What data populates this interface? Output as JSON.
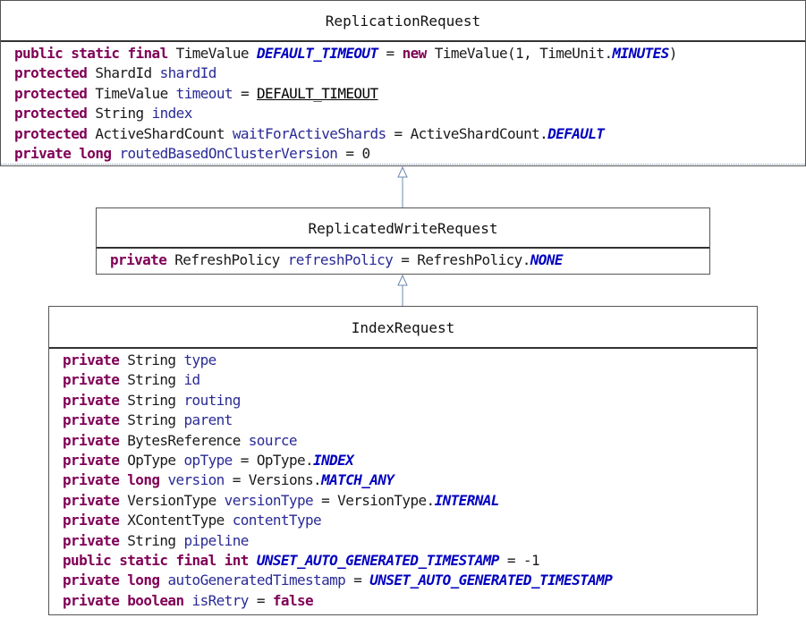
{
  "classes": [
    {
      "name": "ReplicationRequest",
      "fields": [
        [
          {
            "t": "kw",
            "v": "public static final"
          },
          {
            "t": "ty",
            "v": " TimeValue "
          },
          {
            "t": "cn",
            "v": "DEFAULT_TIMEOUT"
          },
          {
            "t": "op",
            "v": " = "
          },
          {
            "t": "kw",
            "v": "new"
          },
          {
            "t": "ty",
            "v": " TimeValue(1, TimeUnit."
          },
          {
            "t": "cn",
            "v": "MINUTES"
          },
          {
            "t": "ty",
            "v": ")"
          }
        ],
        [
          {
            "t": "kw",
            "v": "protected"
          },
          {
            "t": "ty",
            "v": " ShardId "
          },
          {
            "t": "fn",
            "v": "shardId"
          }
        ],
        [
          {
            "t": "kw",
            "v": "protected"
          },
          {
            "t": "ty",
            "v": " TimeValue "
          },
          {
            "t": "fn",
            "v": "timeout"
          },
          {
            "t": "op",
            "v": " = "
          },
          {
            "t": "ul",
            "v": "DEFAULT_TIMEOUT"
          }
        ],
        [
          {
            "t": "kw",
            "v": "protected"
          },
          {
            "t": "ty",
            "v": " String "
          },
          {
            "t": "fn",
            "v": "index"
          }
        ],
        [
          {
            "t": "kw",
            "v": "protected"
          },
          {
            "t": "ty",
            "v": " ActiveShardCount "
          },
          {
            "t": "fn",
            "v": "waitForActiveShards"
          },
          {
            "t": "op",
            "v": " = "
          },
          {
            "t": "ty",
            "v": "ActiveShardCount."
          },
          {
            "t": "cn",
            "v": "DEFAULT"
          }
        ],
        [
          {
            "t": "kw",
            "v": "private long"
          },
          {
            "t": "ty",
            "v": " "
          },
          {
            "t": "fn",
            "v": "routedBasedOnClusterVersion"
          },
          {
            "t": "op",
            "v": " = "
          },
          {
            "t": "lit",
            "v": "0"
          }
        ]
      ]
    },
    {
      "name": "ReplicatedWriteRequest",
      "fields": [
        [
          {
            "t": "kw",
            "v": "private"
          },
          {
            "t": "ty",
            "v": " RefreshPolicy "
          },
          {
            "t": "fn",
            "v": "refreshPolicy"
          },
          {
            "t": "op",
            "v": " = "
          },
          {
            "t": "ty",
            "v": "RefreshPolicy."
          },
          {
            "t": "cn",
            "v": "NONE"
          }
        ]
      ]
    },
    {
      "name": "IndexRequest",
      "fields": [
        [
          {
            "t": "kw",
            "v": "private"
          },
          {
            "t": "ty",
            "v": " String "
          },
          {
            "t": "fn",
            "v": "type"
          }
        ],
        [
          {
            "t": "kw",
            "v": "private"
          },
          {
            "t": "ty",
            "v": " String "
          },
          {
            "t": "fn",
            "v": "id"
          }
        ],
        [
          {
            "t": "kw",
            "v": "private"
          },
          {
            "t": "ty",
            "v": " String "
          },
          {
            "t": "fn",
            "v": "routing"
          }
        ],
        [
          {
            "t": "kw",
            "v": "private"
          },
          {
            "t": "ty",
            "v": " String "
          },
          {
            "t": "fn",
            "v": "parent"
          }
        ],
        [
          {
            "t": "kw",
            "v": "private"
          },
          {
            "t": "ty",
            "v": " BytesReference "
          },
          {
            "t": "fn",
            "v": "source"
          }
        ],
        [
          {
            "t": "kw",
            "v": "private"
          },
          {
            "t": "ty",
            "v": " OpType "
          },
          {
            "t": "fn",
            "v": "opType"
          },
          {
            "t": "op",
            "v": " = "
          },
          {
            "t": "ty",
            "v": "OpType."
          },
          {
            "t": "cn",
            "v": "INDEX"
          }
        ],
        [
          {
            "t": "kw",
            "v": "private long"
          },
          {
            "t": "ty",
            "v": " "
          },
          {
            "t": "fn",
            "v": "version"
          },
          {
            "t": "op",
            "v": " = "
          },
          {
            "t": "ty",
            "v": "Versions."
          },
          {
            "t": "cn",
            "v": "MATCH_ANY"
          }
        ],
        [
          {
            "t": "kw",
            "v": "private"
          },
          {
            "t": "ty",
            "v": " VersionType "
          },
          {
            "t": "fn",
            "v": "versionType"
          },
          {
            "t": "op",
            "v": " = "
          },
          {
            "t": "ty",
            "v": "VersionType."
          },
          {
            "t": "cn",
            "v": "INTERNAL"
          }
        ],
        [
          {
            "t": "kw",
            "v": "private"
          },
          {
            "t": "ty",
            "v": " XContentType "
          },
          {
            "t": "fn",
            "v": "contentType"
          }
        ],
        [
          {
            "t": "kw",
            "v": "private"
          },
          {
            "t": "ty",
            "v": " String "
          },
          {
            "t": "fn",
            "v": "pipeline"
          }
        ],
        [
          {
            "t": "kw",
            "v": "public static final int"
          },
          {
            "t": "ty",
            "v": " "
          },
          {
            "t": "cn",
            "v": "UNSET_AUTO_GENERATED_TIMESTAMP"
          },
          {
            "t": "op",
            "v": " = "
          },
          {
            "t": "lit",
            "v": "-1"
          }
        ],
        [
          {
            "t": "kw",
            "v": "private long"
          },
          {
            "t": "ty",
            "v": " "
          },
          {
            "t": "fn",
            "v": "autoGeneratedTimestamp"
          },
          {
            "t": "op",
            "v": " = "
          },
          {
            "t": "cn",
            "v": "UNSET_AUTO_GENERATED_TIMESTAMP"
          }
        ],
        [
          {
            "t": "kw",
            "v": "private boolean"
          },
          {
            "t": "ty",
            "v": " "
          },
          {
            "t": "fn",
            "v": "isRetry"
          },
          {
            "t": "op",
            "v": " = "
          },
          {
            "t": "kw",
            "v": "false"
          }
        ]
      ]
    }
  ],
  "relations": [
    {
      "from": "ReplicatedWriteRequest",
      "to": "ReplicationRequest",
      "type": "generalization"
    },
    {
      "from": "IndexRequest",
      "to": "ReplicatedWriteRequest",
      "type": "generalization"
    }
  ]
}
